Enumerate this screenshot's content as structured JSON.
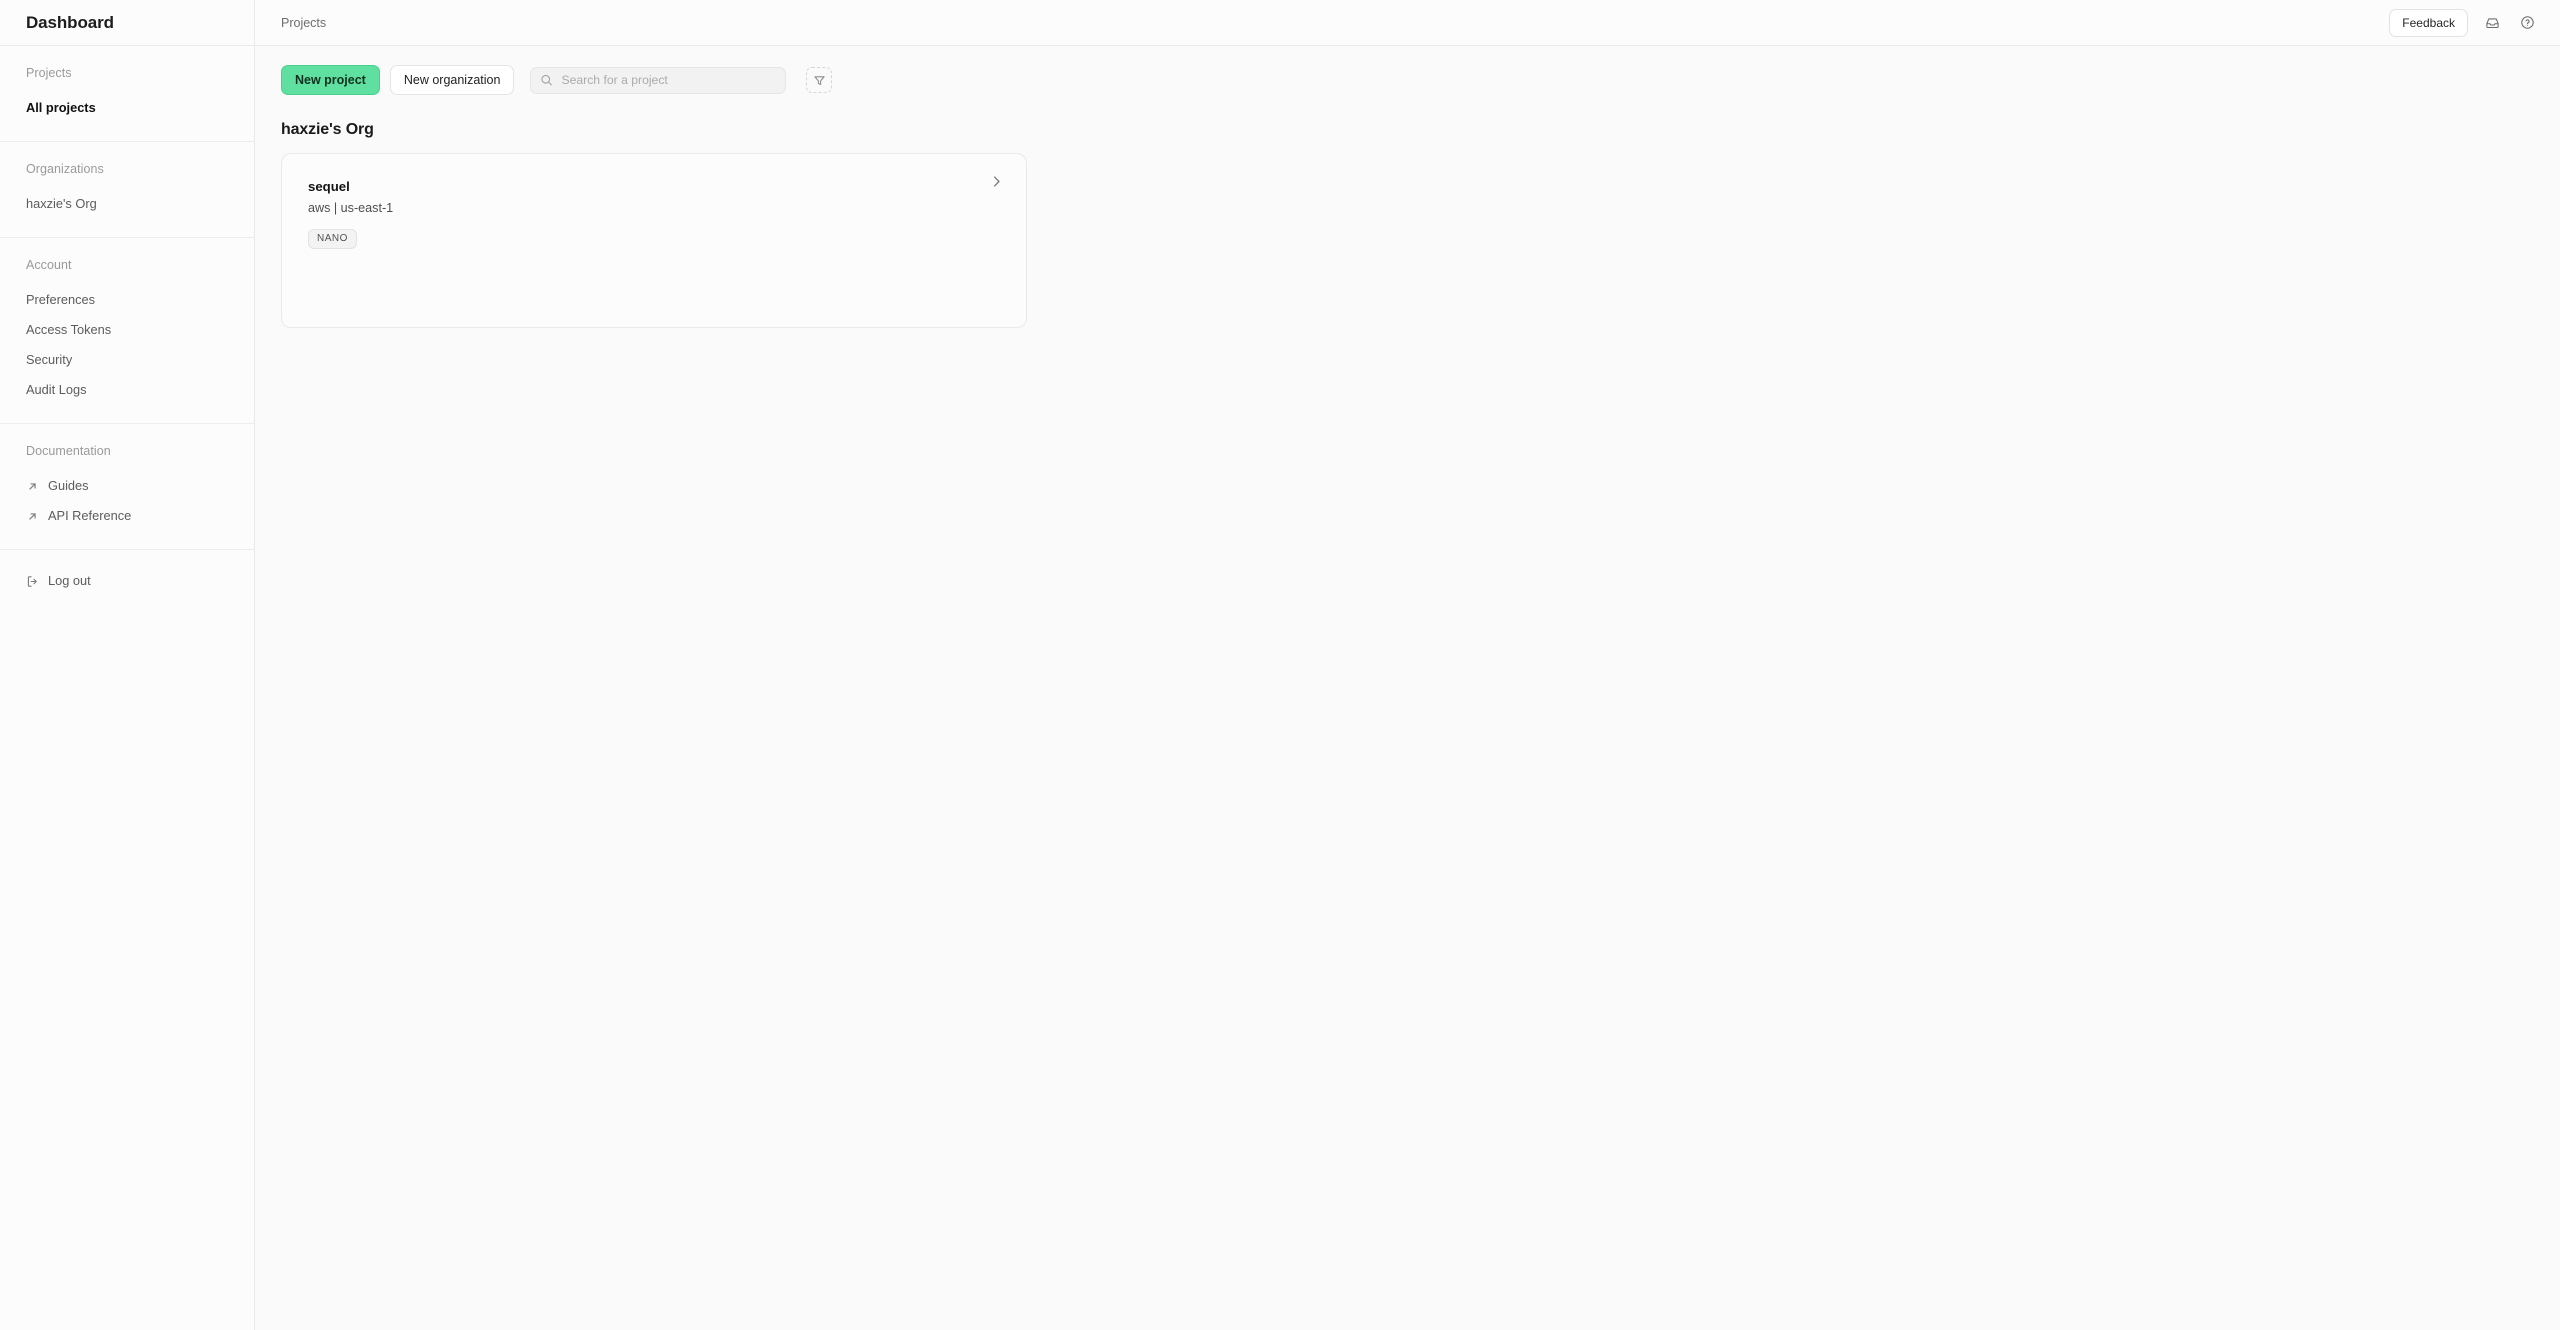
{
  "sidebar": {
    "title": "Dashboard",
    "sections": [
      {
        "label": "Projects",
        "items": [
          {
            "label": "All projects",
            "icon": "",
            "active": true
          }
        ]
      },
      {
        "label": "Organizations",
        "items": [
          {
            "label": "haxzie's Org",
            "icon": "",
            "active": false
          }
        ]
      },
      {
        "label": "Account",
        "items": [
          {
            "label": "Preferences",
            "icon": "",
            "active": false
          },
          {
            "label": "Access Tokens",
            "icon": "",
            "active": false
          },
          {
            "label": "Security",
            "icon": "",
            "active": false
          },
          {
            "label": "Audit Logs",
            "icon": "",
            "active": false
          }
        ]
      },
      {
        "label": "Documentation",
        "items": [
          {
            "label": "Guides",
            "icon": "external-link-icon",
            "active": false
          },
          {
            "label": "API Reference",
            "icon": "external-link-icon",
            "active": false
          }
        ]
      }
    ],
    "logout": {
      "label": "Log out",
      "icon": "logout-icon"
    }
  },
  "topbar": {
    "breadcrumb": "Projects",
    "feedback_label": "Feedback",
    "inbox_icon": "inbox-icon",
    "help_icon": "help-circle-icon"
  },
  "toolbar": {
    "new_project_label": "New project",
    "new_organization_label": "New organization",
    "search_placeholder": "Search for a project",
    "search_value": "",
    "search_icon": "search-icon",
    "filter_icon": "filter-icon"
  },
  "main": {
    "org_heading": "haxzie's Org",
    "projects": [
      {
        "name": "sequel",
        "meta": "aws | us-east-1",
        "badge": "NANO",
        "chevron_icon": "chevron-right-icon"
      }
    ]
  },
  "colors": {
    "accent": "#5fe0a0",
    "background": "#fafafa",
    "panel": "#fcfcfc",
    "border": "#e9e9e9",
    "text": "#1a1a1a",
    "muted": "#9a9a9a"
  }
}
